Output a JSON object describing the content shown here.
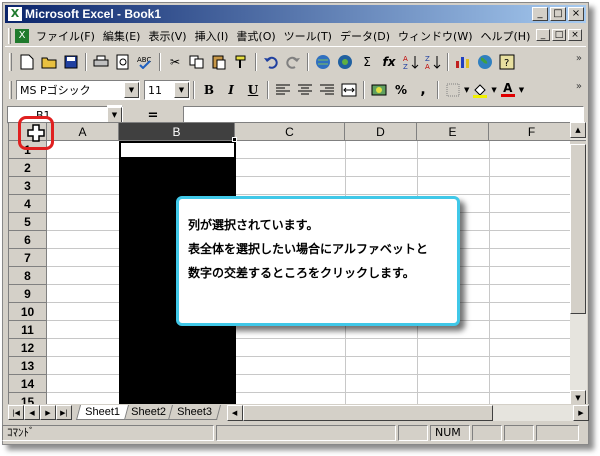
{
  "window": {
    "title": "Microsoft Excel - Book1",
    "title_btns": [
      "_",
      "□",
      "×"
    ],
    "doc_btns": [
      "_",
      "□",
      "×"
    ]
  },
  "menu": {
    "items": [
      "ファイル(F)",
      "編集(E)",
      "表示(V)",
      "挿入(I)",
      "書式(O)",
      "ツール(T)",
      "データ(D)",
      "ウィンドウ(W)",
      "ヘルプ(H)"
    ]
  },
  "toolbar_standard": {
    "tools": [
      "new-icon",
      "open-icon",
      "save-icon",
      "print-icon",
      "print-preview-icon",
      "spelling-icon",
      "cut-icon",
      "copy-icon",
      "paste-icon",
      "format-painter-icon",
      "undo-icon",
      "redo-icon",
      "hyperlink-icon",
      "web-toolbar-icon",
      "autosum-icon",
      "function-icon",
      "sort-ascending-icon",
      "sort-descending-icon",
      "chart-wizard-icon",
      "map-icon",
      "help-icon"
    ],
    "glyphs": {
      "autosum": "Σ",
      "function": "fx"
    }
  },
  "toolbar_formatting": {
    "font_name": "MS Pゴシック",
    "font_size": "11",
    "bold": "B",
    "italic": "I",
    "underline": "U",
    "percent": "%",
    "comma": ",",
    "font_color_letter": "A"
  },
  "formula_bar": {
    "name_box": "B1",
    "equals": "="
  },
  "sheet": {
    "columns": [
      "A",
      "B",
      "C",
      "D",
      "E",
      "F"
    ],
    "selected_column": "B",
    "rows": [
      "1",
      "2",
      "3",
      "4",
      "5",
      "6",
      "7",
      "8",
      "9",
      "10",
      "11",
      "12",
      "13",
      "14",
      "15"
    ]
  },
  "tabs": [
    "Sheet1",
    "Sheet2",
    "Sheet3"
  ],
  "active_tab": "Sheet1",
  "status": {
    "mode": "ｺﾏﾝﾄﾞ",
    "num": "NUM"
  },
  "callout": {
    "line1": "列が選択されています。",
    "line2": "表全体を選択したい場合にアルファベットと",
    "line3": "数字の交差するところをクリックします。"
  },
  "colors": {
    "title_start": "#0a246a",
    "title_end": "#a6caf0",
    "callout_border": "#40c8e8",
    "highlight": "#e02020",
    "selection": "#000000"
  }
}
